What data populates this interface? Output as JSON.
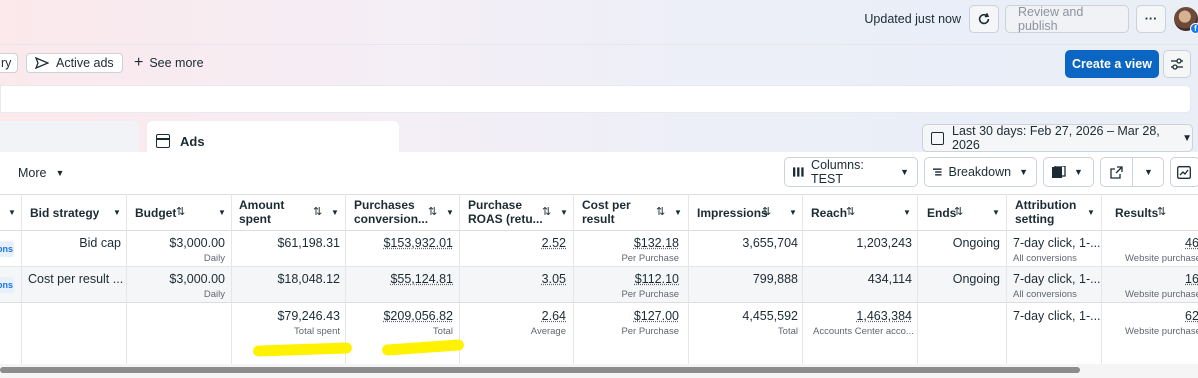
{
  "topbar": {
    "updated_text": "Updated just now",
    "review_label": "Review and publish",
    "more_label": "···"
  },
  "filters": {
    "chip_partial": "ry",
    "active_ads": "Active ads",
    "see_more": "See more",
    "create_view": "Create a view"
  },
  "tabs": {
    "ads": "Ads"
  },
  "date_range": "Last 30 days: Feb 27, 2026 – Mar 28, 2026",
  "toolbar": {
    "more": "More",
    "columns": "Columns: TEST",
    "breakdown": "Breakdown"
  },
  "table": {
    "headers": {
      "bid_strategy": "Bid strategy",
      "budget": "Budget",
      "amount_spent_1": "Amount",
      "amount_spent_2": "spent",
      "purchases_1": "Purchases",
      "purchases_2": "conversion...",
      "roas_1": "Purchase",
      "roas_2": "ROAS (retu...",
      "cpr_1": "Cost per",
      "cpr_2": "result",
      "impressions": "Impressions",
      "reach": "Reach",
      "ends": "Ends",
      "attr_1": "Attribution",
      "attr_2": "setting",
      "results": "Results"
    },
    "rows": [
      {
        "badge": "ons",
        "bid_strategy": "Bid cap",
        "budget": "$3,000.00",
        "budget_sub": "Daily",
        "amount_spent": "$61,198.31",
        "purchases_value": "$153,932.01",
        "roas": "2.52",
        "cpr": "$132.18",
        "cpr_sub": "Per Purchase",
        "impressions": "3,655,704",
        "reach": "1,203,243",
        "ends": "Ongoing",
        "attribution": "7-day click, 1-...",
        "attribution_sub": "All conversions",
        "results": "46",
        "results_sub": "Website purchase"
      },
      {
        "badge": "ons",
        "bid_strategy": "Cost per result ...",
        "budget": "$3,000.00",
        "budget_sub": "Daily",
        "amount_spent": "$18,048.12",
        "purchases_value": "$55,124.81",
        "roas": "3.05",
        "cpr": "$112.10",
        "cpr_sub": "Per Purchase",
        "impressions": "799,888",
        "reach": "434,114",
        "ends": "Ongoing",
        "attribution": "7-day click, 1-...",
        "attribution_sub": "All conversions",
        "results": "16",
        "results_sub": "Website purchase"
      }
    ],
    "totals": {
      "amount_spent": "$79,246.43",
      "amount_spent_sub": "Total spent",
      "purchases_value": "$209,056.82",
      "purchases_sub": "Total",
      "roas": "2.64",
      "roas_sub": "Average",
      "cpr": "$127.00",
      "cpr_sub": "Per Purchase",
      "impressions": "4,455,592",
      "impressions_sub": "Total",
      "reach": "1,463,384",
      "reach_sub": "Accounts Center acco...",
      "attribution": "7-day click, 1-...",
      "results": "62",
      "results_sub": "Website purchase"
    }
  },
  "colors": {
    "primary": "#0a66c2",
    "highlight": "#fff200",
    "badge_text": "#1b74e4"
  },
  "icons": [
    "refresh-icon",
    "columns-icon",
    "breakdown-icon",
    "reports-icon",
    "export-icon",
    "chart-icon",
    "calendar-icon",
    "settings-sliders-icon",
    "send-icon",
    "plus-icon"
  ]
}
